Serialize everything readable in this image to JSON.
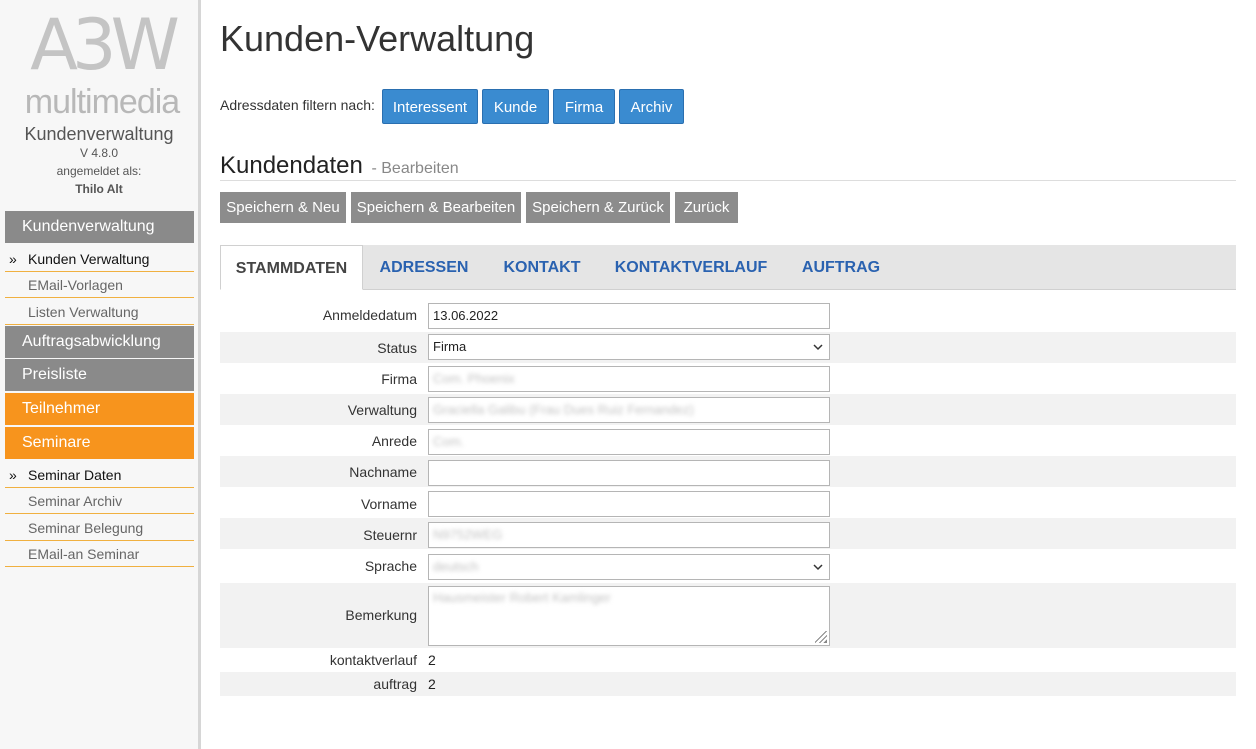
{
  "sidebar": {
    "logo_top": "A3W",
    "logo_bottom": "multimedia",
    "app_name": "Kundenverwaltung",
    "version": "V 4.8.0",
    "logged_in_label": "angemeldet als:",
    "user": "Thilo Alt",
    "sections": [
      {
        "label": "Kundenverwaltung",
        "items": [
          "Kunden Verwaltung",
          "EMail-Vorlagen",
          "Listen Verwaltung"
        ]
      },
      {
        "label": "Auftragsabwicklung"
      },
      {
        "label": "Preisliste"
      },
      {
        "label": "Teilnehmer"
      },
      {
        "label": "Seminare",
        "items": [
          "Seminar Daten",
          "Seminar Archiv",
          "Seminar Belegung",
          "EMail-an Seminar"
        ]
      }
    ],
    "bullet": "»",
    "colors": {
      "gray": "#8a8a8a",
      "orange": "#f7941d"
    }
  },
  "page": {
    "title": "Kunden-Verwaltung",
    "filter_label": "Adressdaten filtern nach:",
    "filters": [
      "Interessent",
      "Kunde",
      "Firma",
      "Archiv"
    ],
    "section_title": "Kundendaten",
    "section_sub": "- Bearbeiten",
    "actions": [
      "Speichern & Neu",
      "Speichern & Bearbeiten",
      "Speichern & Zurück",
      "Zurück"
    ]
  },
  "tabs": [
    "STAMMDATEN",
    "ADRESSEN",
    "KONTAKT",
    "KONTAKTVERLAUF",
    "AUFTRAG"
  ],
  "form": {
    "anmeldedatum": {
      "label": "Anmeldedatum",
      "value": "13.06.2022"
    },
    "status": {
      "label": "Status",
      "value": "Firma"
    },
    "firma": {
      "label": "Firma",
      "value": "Com. Phoenix"
    },
    "verwaltung": {
      "label": "Verwaltung",
      "value": "Graciella Galibu (Frau Dues Ruiz Fernandez)"
    },
    "anrede": {
      "label": "Anrede",
      "value": "Com."
    },
    "nachname": {
      "label": "Nachname",
      "value": ""
    },
    "vorname": {
      "label": "Vorname",
      "value": ""
    },
    "steuernr": {
      "label": "Steuernr",
      "value": "N9752WEG"
    },
    "sprache": {
      "label": "Sprache",
      "value": "deutsch"
    },
    "bemerkung": {
      "label": "Bemerkung",
      "value": "Hausmeister Robert Kamlinger"
    },
    "kontaktverlauf": {
      "label": "kontaktverlauf",
      "value": "2"
    },
    "auftrag": {
      "label": "auftrag",
      "value": "2"
    }
  },
  "icons": {
    "select": "chevron-down-icon",
    "resize": "resize-handle-icon"
  },
  "colors": {
    "primary_button": "#3a8bd0",
    "action_button": "#8c8c8c",
    "tab_link": "#2a62b0"
  }
}
